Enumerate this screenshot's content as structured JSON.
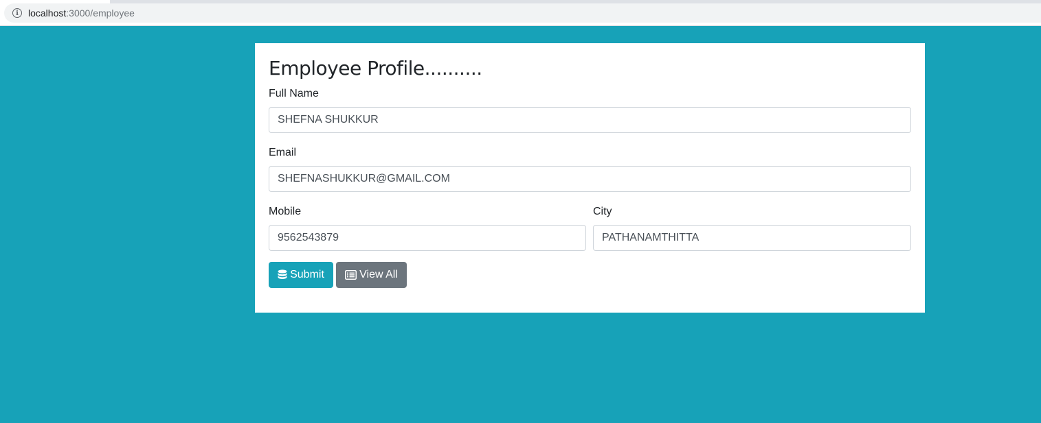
{
  "browser": {
    "url_host": "localhost",
    "url_path": ":3000/employee",
    "info_icon": "info-icon"
  },
  "form": {
    "title": "Employee Profile..........",
    "full_name": {
      "label": "Full Name",
      "value": "SHEFNA SHUKKUR"
    },
    "email": {
      "label": "Email",
      "value": "SHEFNASHUKKUR@GMAIL.COM"
    },
    "mobile": {
      "label": "Mobile",
      "value": "9562543879"
    },
    "city": {
      "label": "City",
      "value": "PATHANAMTHITTA"
    },
    "submit_label": "Submit",
    "submit_icon": "database-icon",
    "view_all_label": "View All",
    "view_all_icon": "list-icon"
  },
  "colors": {
    "background": "#17a2b8",
    "submit_button": "#17a2b8",
    "view_all_button": "#6c757d"
  }
}
